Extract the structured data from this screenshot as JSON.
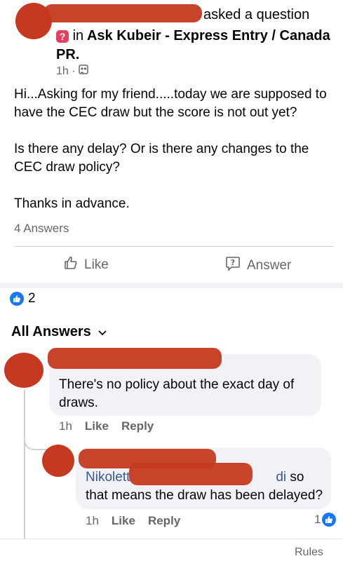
{
  "post": {
    "action_text": "asked a question",
    "group_prefix": "in",
    "group_name": "Ask Kubeir - Express Entry / Canada PR.",
    "time": "1h ·",
    "paragraph1": "Hi...Asking for my friend.....today we are supposed to have the CEC draw but the score is not out yet?",
    "paragraph2": "Is there any delay? Or is there any changes to the CEC draw policy?",
    "paragraph3": "Thanks in advance.",
    "answers_count": "4 Answers"
  },
  "actions": {
    "like_label": "Like",
    "answer_label": "Answer"
  },
  "reactions": {
    "count": "2"
  },
  "all_answers": {
    "label": "All Answers"
  },
  "comments": [
    {
      "text": "There's no policy about the exact day of draws.",
      "time": "1h",
      "like_label": "Like",
      "reply_label": "Reply"
    },
    {
      "mention_start": "Nikolett",
      "mention_end": "di",
      "text": " so that means the draw has been delayed?",
      "time": "1h",
      "like_label": "Like",
      "reply_label": "Reply",
      "reaction_count": "1"
    }
  ],
  "footer": {
    "rules_label": "Rules"
  }
}
